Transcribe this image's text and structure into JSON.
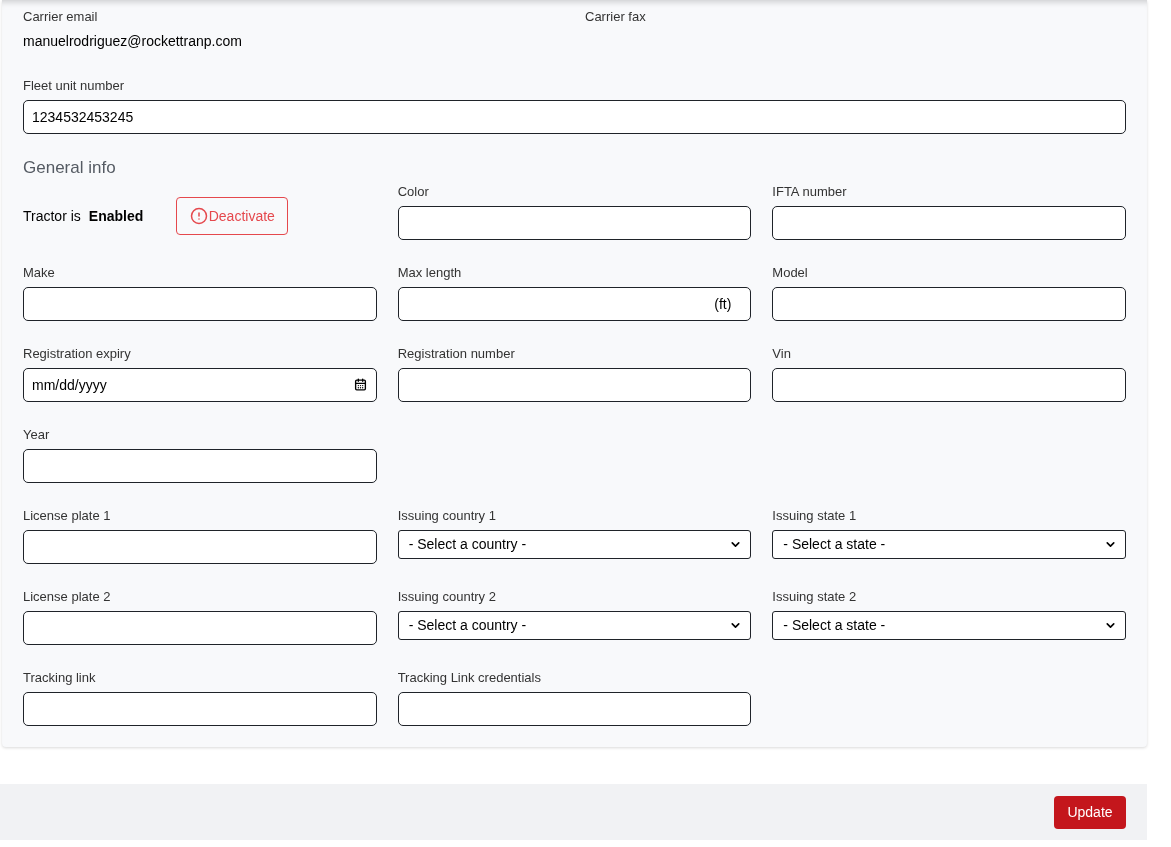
{
  "carrier": {
    "email_label": "Carrier email",
    "email": "manuelrodriguez@rockettranp.com",
    "fax_label": "Carrier fax"
  },
  "fleet_unit": {
    "label": "Fleet unit number",
    "value": "1234532453245"
  },
  "general_info": {
    "title": "General info",
    "rows": [
      [
        {
          "kind": "status",
          "label": "Tractor is",
          "value": "Enabled",
          "button": "Deactivate"
        },
        {
          "kind": "text",
          "label": "Color"
        },
        {
          "kind": "text",
          "label": "IFTA number"
        }
      ],
      [
        {
          "kind": "text",
          "label": "Make"
        },
        {
          "kind": "text",
          "label": "Max length",
          "suffix": "(ft)"
        },
        {
          "kind": "text",
          "label": "Model"
        }
      ],
      [
        {
          "kind": "date",
          "label": "Registration expiry",
          "placeholder": "mm/dd/yyyy"
        },
        {
          "kind": "text",
          "label": "Registration number"
        },
        {
          "kind": "text",
          "label": "Vin"
        }
      ],
      [
        {
          "kind": "text",
          "label": "Year"
        }
      ],
      [
        {
          "kind": "text",
          "label": "License plate 1"
        },
        {
          "kind": "select",
          "label": "Issuing country 1",
          "value": "- Select a country -"
        },
        {
          "kind": "select",
          "label": "Issuing state 1",
          "value": "- Select a state -"
        }
      ],
      [
        {
          "kind": "text",
          "label": "License plate 2"
        },
        {
          "kind": "select",
          "label": "Issuing country 2",
          "value": "- Select a country -"
        },
        {
          "kind": "select",
          "label": "Issuing state 2",
          "value": "- Select a state -"
        }
      ],
      [
        {
          "kind": "text",
          "label": "Tracking link"
        },
        {
          "kind": "text",
          "label": "Tracking Link credentials"
        }
      ]
    ]
  },
  "footer": {
    "update_button": "Update"
  }
}
